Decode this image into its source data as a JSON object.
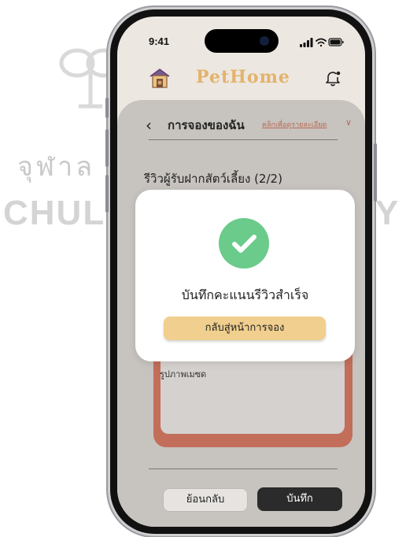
{
  "status": {
    "time": "9:41"
  },
  "app": {
    "brand": "PetHome"
  },
  "header": {
    "title": "การจองของฉัน",
    "detail_link": "คลิกเพื่อดูรายละเอียด"
  },
  "section": {
    "title": "รีวิวผู้รับฝากสัตว์เลี้ยง (2/2)"
  },
  "photo": {
    "label": "รูปภาพเมซด"
  },
  "buttons": {
    "back": "ย้อนกลับ",
    "save": "บันทึก"
  },
  "modal": {
    "message": "บันทึกคะแนนรีวิวสำเร็จ",
    "button": "กลับสู่หน้าการจอง"
  },
  "watermark": {
    "thai": "จุฬาล",
    "eng_left": "CHULAL",
    "eng_right": "TY"
  },
  "colors": {
    "brand": "#e3b36b",
    "success": "#6acb8a",
    "modal_button": "#f1cf8e",
    "card": "#c26e5a",
    "primary_button": "#2b2b2b"
  },
  "icons": [
    "logo-icon",
    "bell-icon",
    "back-icon",
    "chevron-down-icon",
    "check-icon",
    "signal-icon",
    "wifi-icon",
    "battery-icon"
  ]
}
